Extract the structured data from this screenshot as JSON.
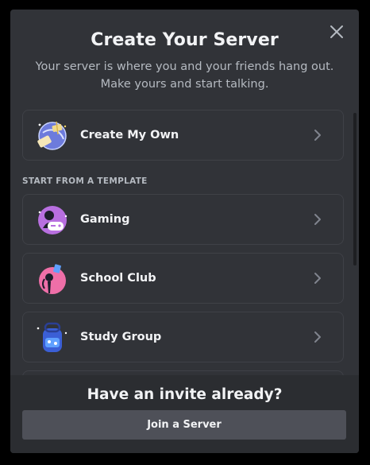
{
  "modal": {
    "title": "Create Your Server",
    "subtitle": "Your server is where you and your friends hang out. Make yours and start talking."
  },
  "create_option": {
    "label": "Create My Own",
    "icon": "globe-flag-icon"
  },
  "template_section": {
    "label": "START FROM A TEMPLATE",
    "items": [
      {
        "label": "Gaming",
        "icon": "gaming-icon"
      },
      {
        "label": "School Club",
        "icon": "school-club-icon"
      },
      {
        "label": "Study Group",
        "icon": "study-group-icon"
      }
    ]
  },
  "footer": {
    "title": "Have an invite already?",
    "join_label": "Join a Server"
  },
  "colors": {
    "background": "#313338",
    "footer": "#2b2d31",
    "button": "#4e5058",
    "text": "#f2f3f5",
    "muted": "#b5bac1"
  }
}
